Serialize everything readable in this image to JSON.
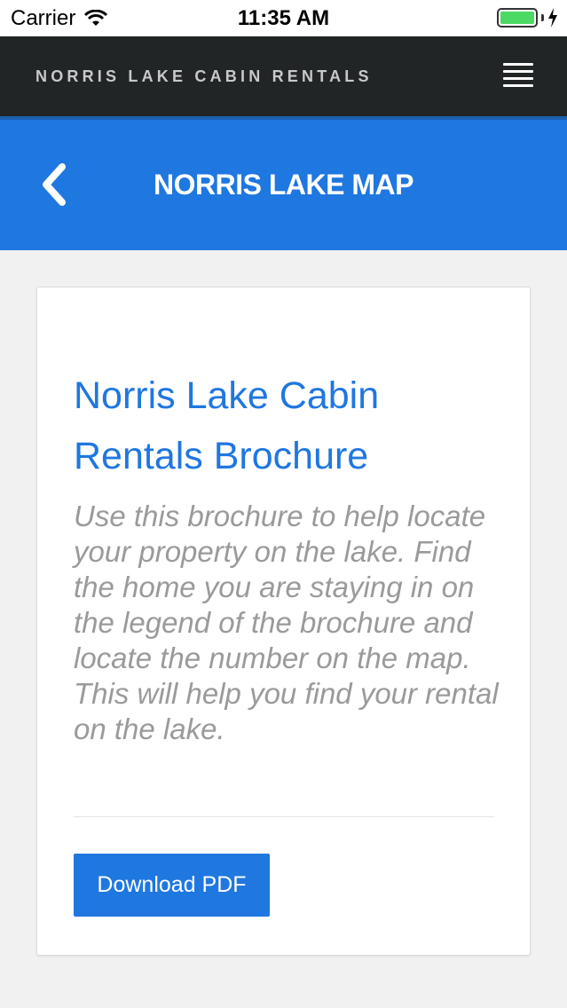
{
  "status_bar": {
    "carrier": "Carrier",
    "time": "11:35 AM"
  },
  "topbar": {
    "brand": "NORRIS LAKE CABIN RENTALS",
    "menu_icon": "hamburger-menu-icon"
  },
  "header": {
    "title": "NORRIS LAKE MAP",
    "back_icon": "chevron-left-icon"
  },
  "card": {
    "title": "Norris Lake Cabin Rentals Brochure",
    "description": "Use this brochure to help locate your property on the lake. Find the home you are staying in on the legend of the brochure and locate the number on the map. This will help you find your rental on the lake.",
    "button_label": "Download PDF"
  },
  "colors": {
    "accent": "#1f77e0",
    "topbar": "#222526",
    "battery": "#4cd964"
  }
}
